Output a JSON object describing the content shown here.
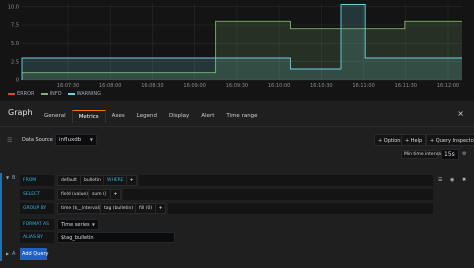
{
  "chart_data": {
    "type": "area",
    "x": [
      "16:07:30",
      "16:08:00",
      "16:08:30",
      "16:09:00",
      "16:09:30",
      "16:10:00",
      "16:10:30",
      "16:11:00",
      "16:11:30",
      "16:12:00"
    ],
    "x_ticks": [
      "16:07:30",
      "16:08:00",
      "16:08:30",
      "16:09:00",
      "16:09:30",
      "16:10:00",
      "16:10:30",
      "16:11:00",
      "16:11:30",
      "16:12:00"
    ],
    "y_ticks": [
      "0",
      "2.5",
      "5.0",
      "7.5",
      "10.0"
    ],
    "ylim": [
      0,
      10.5
    ],
    "grid": true,
    "legend_position": "bottom-left",
    "series": [
      {
        "name": "ERROR",
        "color": "#d44a3a",
        "points": [
          [
            0,
            0
          ]
        ]
      },
      {
        "name": "INFO",
        "color": "#7eb26d",
        "points": [
          [
            0,
            0
          ],
          [
            0,
            1
          ],
          [
            0.44,
            1
          ],
          [
            0.44,
            8
          ],
          [
            0.61,
            8
          ],
          [
            0.61,
            7
          ],
          [
            0.87,
            7
          ],
          [
            0.87,
            8
          ],
          [
            1,
            8
          ]
        ]
      },
      {
        "name": "WARNING",
        "color": "#6ed0e0",
        "points": [
          [
            0,
            0
          ],
          [
            0,
            3
          ],
          [
            0.61,
            3
          ],
          [
            0.61,
            1.5
          ],
          [
            0.725,
            1.5
          ],
          [
            0.725,
            10.3
          ],
          [
            0.78,
            10.3
          ],
          [
            0.78,
            3
          ],
          [
            1,
            3
          ]
        ]
      }
    ]
  },
  "editor": {
    "title": "Graph",
    "tabs": [
      "General",
      "Metrics",
      "Axes",
      "Legend",
      "Display",
      "Alert",
      "Time range"
    ],
    "active_tab": "Metrics",
    "close_label": "×",
    "data_source_label": "Data Source",
    "data_source_value": "influxdb",
    "options_label": "+ Options",
    "help_label": "+ Help",
    "query_inspector_label": "+ Query Inspector",
    "min_interval_label": "Min time interval",
    "min_interval_value": "15s",
    "info_icon": "i"
  },
  "query": {
    "ref_id": "B",
    "from_label": "FROM",
    "from_policy": "default",
    "from_measurement": "bulletin",
    "where_label": "WHERE",
    "select_label": "SELECT",
    "select_field": "field (value)",
    "select_fn": "sum ()",
    "group_by_label": "GROUP BY",
    "group_by_time": "time ($__interval)",
    "group_by_tag": "tag (bulletin)",
    "group_by_fill": "fill (0)",
    "format_as_label": "FORMAT AS",
    "format_as_value": "Time series",
    "alias_label": "ALIAS BY",
    "alias_value": "$tag_bulletin",
    "plus": "+"
  },
  "add_query": {
    "ref_id": "A",
    "label": "Add Query"
  }
}
